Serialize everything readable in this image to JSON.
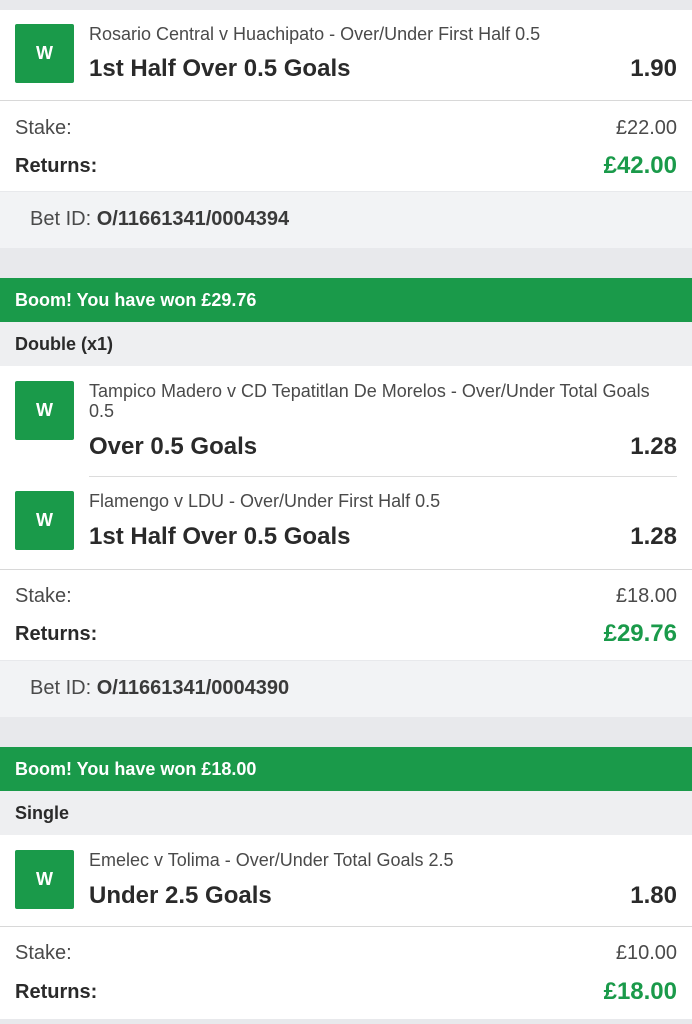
{
  "bet1": {
    "badge": "W",
    "event": "Rosario Central v Huachipato - Over/Under First Half 0.5",
    "selection": "1st Half Over 0.5 Goals",
    "odds": "1.90",
    "stake_label": "Stake:",
    "stake": "£22.00",
    "returns_label": "Returns:",
    "returns": "£42.00",
    "bet_id_label": "Bet ID:",
    "bet_id": "O/11661341/0004394"
  },
  "bet2": {
    "banner": "Boom! You have won £29.76",
    "type": "Double (x1)",
    "legs": [
      {
        "badge": "W",
        "event": "Tampico Madero v CD Tepatitlan De Morelos - Over/Under Total Goals 0.5",
        "selection": "Over 0.5 Goals",
        "odds": "1.28"
      },
      {
        "badge": "W",
        "event": "Flamengo v LDU - Over/Under First Half 0.5",
        "selection": "1st Half Over 0.5 Goals",
        "odds": "1.28"
      }
    ],
    "stake_label": "Stake:",
    "stake": "£18.00",
    "returns_label": "Returns:",
    "returns": "£29.76",
    "bet_id_label": "Bet ID:",
    "bet_id": "O/11661341/0004390"
  },
  "bet3": {
    "banner": "Boom! You have won £18.00",
    "type": "Single",
    "badge": "W",
    "event": "Emelec v Tolima - Over/Under Total Goals 2.5",
    "selection": "Under 2.5 Goals",
    "odds": "1.80",
    "stake_label": "Stake:",
    "stake": "£10.00",
    "returns_label": "Returns:",
    "returns": "£18.00"
  },
  "colors": {
    "win_green": "#1a9a4a",
    "background": "#e8e9ec"
  }
}
